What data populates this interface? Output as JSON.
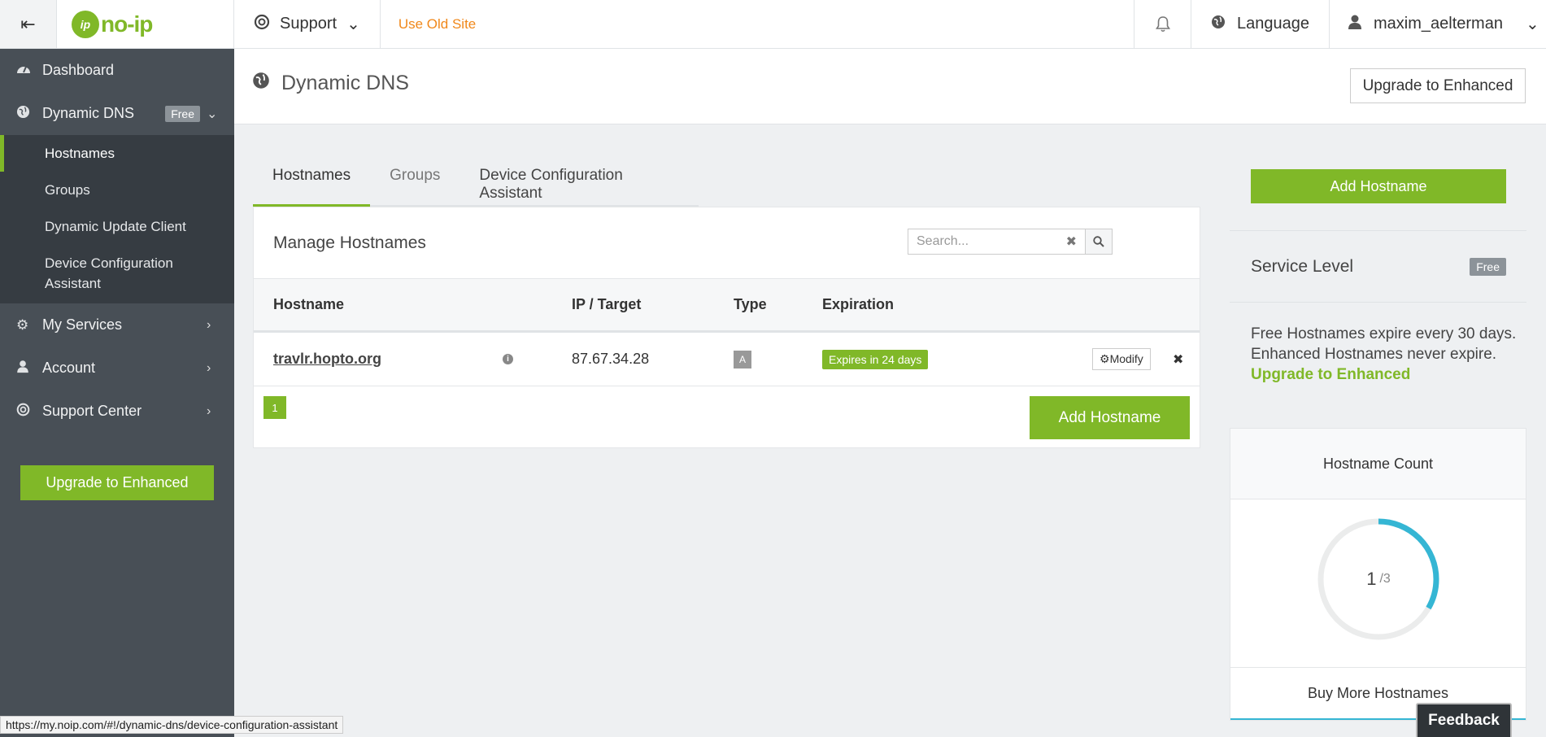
{
  "topbar": {
    "toggle_icon": "menu-collapse-icon",
    "logo_text": "no-ip",
    "support_label": "Support",
    "old_site_label": "Use Old Site",
    "language_label": "Language",
    "username": "maxim_aelterman",
    "colors": {
      "accent": "#80b828",
      "old_site": "#f0881b"
    }
  },
  "sidebar": {
    "items": [
      {
        "label": "Dashboard",
        "icon": "dashboard-icon"
      },
      {
        "label": "Dynamic DNS",
        "icon": "globe-icon",
        "badge": "Free"
      },
      {
        "label": "My Services",
        "icon": "gear-icon"
      },
      {
        "label": "Account",
        "icon": "user-icon"
      },
      {
        "label": "Support Center",
        "icon": "lifebuoy-icon"
      }
    ],
    "sub_items": [
      {
        "label": "Hostnames"
      },
      {
        "label": "Groups"
      },
      {
        "label": "Dynamic Update Client"
      },
      {
        "label": "Device Configuration Assistant"
      }
    ],
    "upgrade_label": "Upgrade to Enhanced",
    "bg_color": "#484f56"
  },
  "header": {
    "title": "Dynamic DNS",
    "upgrade_label": "Upgrade to Enhanced"
  },
  "tabs": [
    {
      "label": "Hostnames"
    },
    {
      "label": "Groups"
    },
    {
      "label": "Device Configuration Assistant"
    }
  ],
  "manage": {
    "title": "Manage Hostnames",
    "search_placeholder": "Search...",
    "columns": [
      "Hostname",
      "IP / Target",
      "Type",
      "Expiration"
    ],
    "rows": [
      {
        "hostname": "travlr.hopto.org",
        "ip": "87.67.34.28",
        "type": "A",
        "expiration": "Expires in 24 days",
        "modify_label": "Modify"
      }
    ],
    "page": "1",
    "add_label": "Add Hostname"
  },
  "right": {
    "add_label": "Add Hostname",
    "service_level_label": "Service Level",
    "service_level_badge": "Free",
    "desc_line1": "Free Hostnames expire every 30 days.",
    "desc_line2": "Enhanced Hostnames never expire.",
    "upgrade_link": "Upgrade to Enhanced",
    "count_title": "Hostname Count",
    "count_used": "1",
    "count_total": "/3",
    "buy_more": "Buy More Hostnames",
    "count_fraction": 0.3333,
    "ring_color": "#35b6d4"
  },
  "status_url": "https://my.noip.com/#!/dynamic-dns/device-configuration-assistant",
  "feedback_label": "Feedback"
}
